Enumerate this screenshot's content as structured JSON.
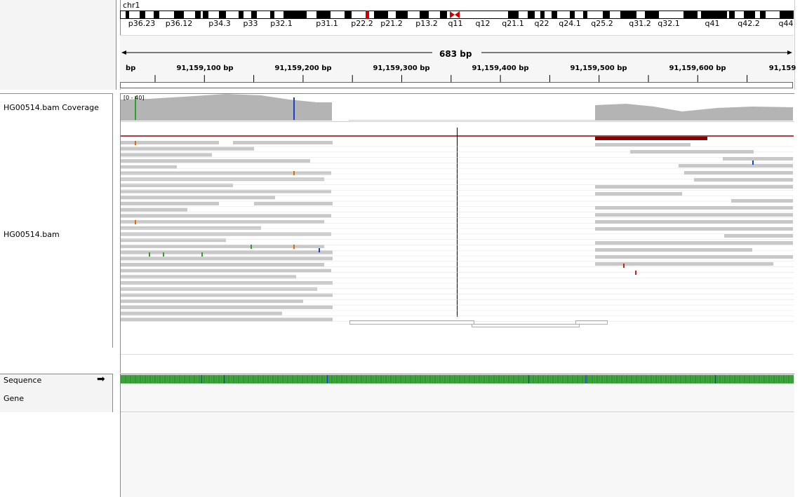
{
  "chromosome": "chr1",
  "cytobands": [
    "p36.23",
    "p36.12",
    "p34.3",
    "p33",
    "p32.1",
    "p31.1",
    "p22.2",
    "p21.2",
    "p13.2",
    "q11",
    "q12",
    "q21.1",
    "q22",
    "q24.1",
    "q25.2",
    "q31.2",
    "q32.1",
    "q41",
    "q42.2",
    "q44"
  ],
  "span_label": "683 bp",
  "ruler_ticks": [
    "bp",
    "91,159,100 bp",
    "91,159,200 bp",
    "91,159,300 bp",
    "91,159,400 bp",
    "91,159,500 bp",
    "91,159,600 bp",
    "91,159"
  ],
  "coverage_range": "[0 - 40]",
  "tracks": {
    "coverage": "HG00514.bam Coverage",
    "alignment": "HG00514.bam",
    "sequence": "Sequence",
    "gene": "Gene"
  },
  "icons": {
    "sequence_strand": "right-arrow-icon"
  },
  "colors": {
    "read": "#c8c8c8",
    "coverage": "#b4b4b4",
    "deletion_bar": "#8b0000",
    "centromere": "#d00000"
  }
}
